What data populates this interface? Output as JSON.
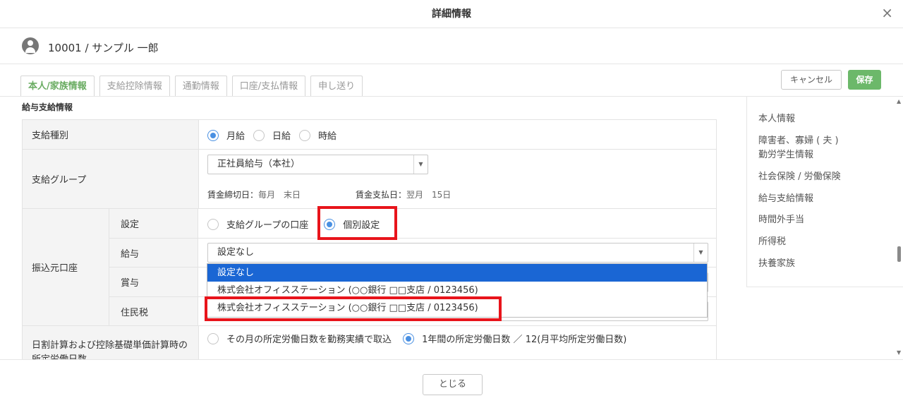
{
  "header": {
    "title": "詳細情報",
    "close_label": "×"
  },
  "employee": {
    "name": "10001 / サンプル 一郎"
  },
  "tabs": [
    {
      "label": "本人/家族情報",
      "active": true
    },
    {
      "label": "支給控除情報",
      "active": false
    },
    {
      "label": "通勤情報",
      "active": false
    },
    {
      "label": "口座/支払情報",
      "active": false
    },
    {
      "label": "申し送り",
      "active": false
    }
  ],
  "actions": {
    "cancel": "キャンセル",
    "save": "保存"
  },
  "section": {
    "title": "給与支給情報"
  },
  "form": {
    "pay_type": {
      "label": "支給種別",
      "options": [
        "月給",
        "日給",
        "時給"
      ],
      "selected": "月給"
    },
    "pay_group": {
      "label": "支給グループ",
      "value": "正社員給与（本社）",
      "cutoff_label": "賃金締切日：",
      "cutoff_value": "毎月　末日",
      "payday_label": "賃金支払日：",
      "payday_value": "翌月　15日"
    },
    "transfer": {
      "label": "振込元口座",
      "setting_label": "設定",
      "setting_options": [
        "支給グループの口座",
        "個別設定"
      ],
      "setting_selected": "個別設定",
      "salary_label": "給与",
      "salary_value": "設定なし",
      "bonus_label": "賞与",
      "resident_tax_label": "住民税"
    },
    "daily_calc": {
      "label": "日割計算および控除基礎単価計算時の所定労働日数",
      "options": [
        "その月の所定労働日数を勤務実績で取込",
        "1年間の所定労働日数 ／ 12(月平均所定労働日数)"
      ],
      "selected": "1年間の所定労働日数 ／ 12(月平均所定労働日数)"
    }
  },
  "dropdown": {
    "items": [
      "設定なし",
      "株式会社オフィスステーション (○○銀行 □□支店 / 0123456)",
      "株式会社オフィスステーション (○○銀行 □□支店 / 0123456)"
    ],
    "selected_index": 0
  },
  "side_nav": [
    "本人情報",
    "障害者、寡婦 ( 夫 )",
    "勤労学生情報",
    "社会保険 / 労働保険",
    "給与支給情報",
    "時間外手当",
    "所得税",
    "扶養家族"
  ],
  "footer": {
    "close_button": "とじる"
  },
  "colors": {
    "accent_green": "#6cb86a",
    "tab_active": "#6aac62",
    "radio_blue": "#4a90e2",
    "dropdown_selected": "#1a66d4",
    "highlight_red": "#e8141b"
  },
  "icons": {
    "close": "close-icon",
    "avatar": "user-avatar-icon",
    "select_arrow": "caret-down-icon"
  }
}
